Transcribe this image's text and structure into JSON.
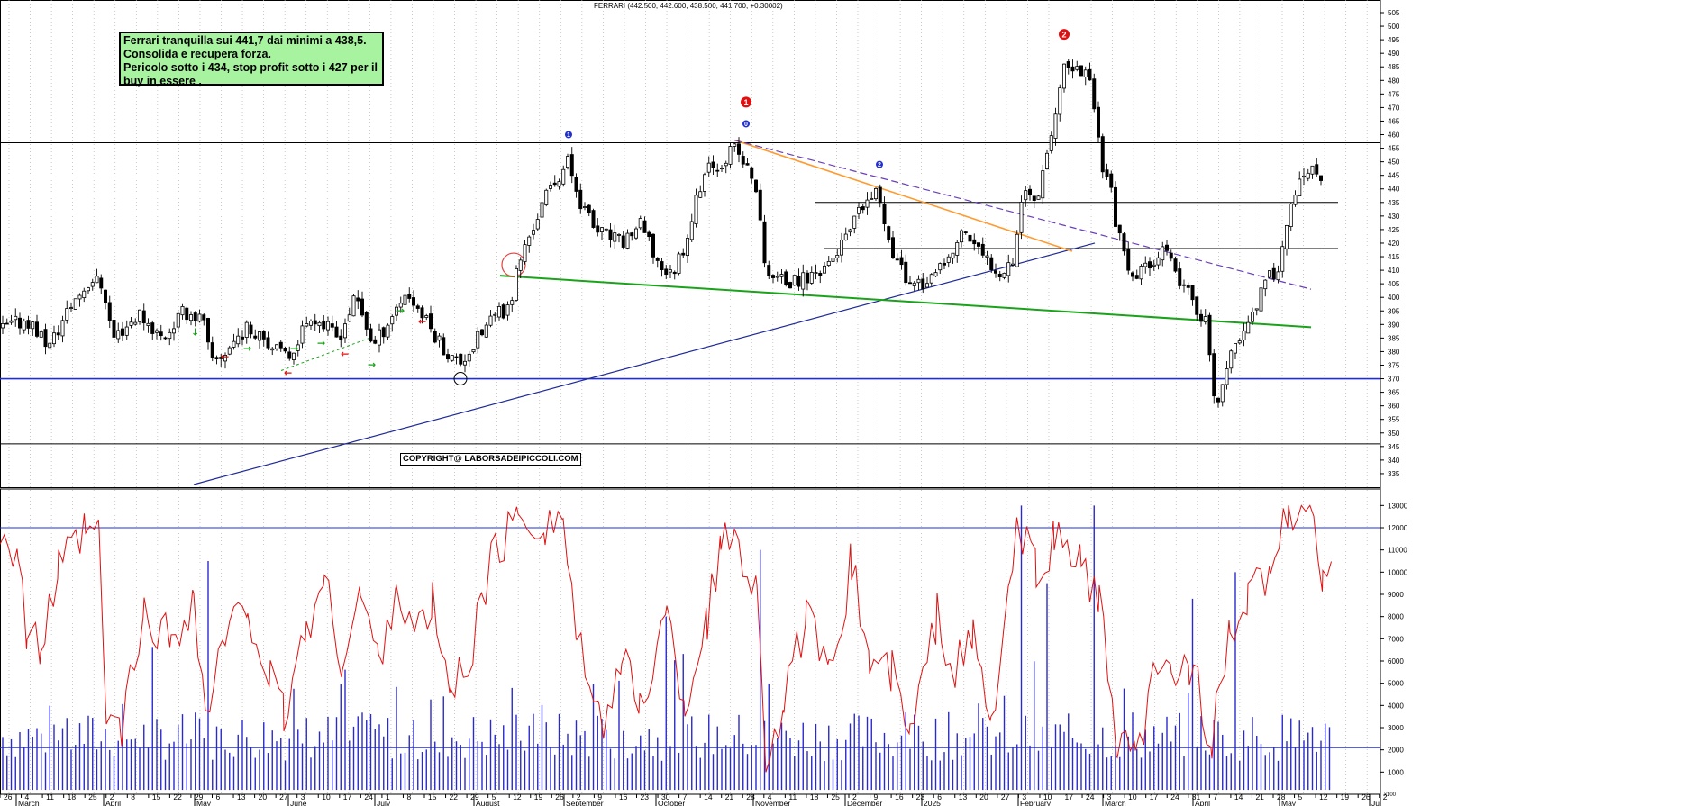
{
  "title": "FERRARI (442.500, 442.600, 438.500, 441.700, +0.30002)",
  "note": {
    "lines": [
      "Ferrari tranquilla sui 441,7 dai minimi a 438,5.",
      "Consolida e recupera forza.",
      "Pericolo sotto i 434, stop profit sotto i 427 per il",
      "buy in essere ."
    ]
  },
  "copyright": "COPYRIGHT@ LABORSADEIPICCOLI.COM",
  "colors": {
    "candle": "#000000",
    "hline": "#000000",
    "support": "#1f2fd0",
    "uptrend": "#1f2a9a",
    "green_trend": "#1aa31a",
    "orange_trend": "#ff9a2e",
    "dashed_trend": "#6a3fb8",
    "volume": "#2a2acc",
    "oscillator": "#e01010",
    "marker_red": "#e01010",
    "marker_blue": "#1f2fd0",
    "note_bg": "#a7f3a0"
  },
  "chart_data": [
    {
      "type": "candlestick",
      "title": "FERRARI (442.500, 442.600, 438.500, 441.700, +0.30002)",
      "y_axis": {
        "range": [
          330,
          505
        ],
        "ticks": [
          335,
          340,
          345,
          350,
          355,
          360,
          365,
          370,
          375,
          380,
          385,
          390,
          395,
          400,
          405,
          410,
          415,
          420,
          425,
          430,
          435,
          440,
          445,
          450,
          455,
          460,
          465,
          470,
          475,
          480,
          485,
          490,
          495,
          500,
          505
        ]
      },
      "months": [
        "March",
        "April",
        "May",
        "June",
        "July",
        "August",
        "September",
        "October",
        "November",
        "December",
        "2025",
        "February",
        "March",
        "April",
        "May",
        "Jui"
      ],
      "day_ticks": [
        "26",
        "4",
        "11",
        "18",
        "25",
        "2",
        "8",
        "15",
        "22",
        "29",
        "6",
        "13",
        "20",
        "27",
        "3",
        "10",
        "17",
        "24",
        "1",
        "8",
        "15",
        "22",
        "29",
        "5",
        "12",
        "19",
        "26",
        "2",
        "9",
        "16",
        "23",
        "30",
        "7",
        "14",
        "21",
        "28",
        "4",
        "11",
        "18",
        "25",
        "2",
        "9",
        "16",
        "23",
        "6",
        "13",
        "20",
        "27",
        "3",
        "10",
        "17",
        "24",
        "3",
        "10",
        "17",
        "24",
        "31",
        "7",
        "14",
        "21",
        "28",
        "5",
        "12",
        "19",
        "26",
        "2"
      ],
      "path": [
        [
          0,
          388
        ],
        [
          30,
          392
        ],
        [
          55,
          382
        ],
        [
          80,
          398
        ],
        [
          102,
          407
        ],
        [
          115,
          404
        ],
        [
          125,
          385
        ],
        [
          155,
          394
        ],
        [
          180,
          385
        ],
        [
          205,
          395
        ],
        [
          225,
          392
        ],
        [
          235,
          375
        ],
        [
          250,
          380
        ],
        [
          270,
          388
        ],
        [
          290,
          388
        ],
        [
          305,
          380
        ],
        [
          320,
          378
        ],
        [
          345,
          394
        ],
        [
          375,
          385
        ],
        [
          395,
          400
        ],
        [
          415,
          382
        ],
        [
          425,
          388
        ],
        [
          450,
          402
        ],
        [
          460,
          398
        ],
        [
          475,
          390
        ],
        [
          500,
          378
        ],
        [
          510,
          376
        ],
        [
          525,
          382
        ],
        [
          545,
          392
        ],
        [
          565,
          396
        ],
        [
          575,
          412
        ],
        [
          590,
          425
        ],
        [
          610,
          440
        ],
        [
          630,
          450
        ],
        [
          645,
          435
        ],
        [
          660,
          425
        ],
        [
          690,
          420
        ],
        [
          710,
          427
        ],
        [
          730,
          413
        ],
        [
          745,
          408
        ],
        [
          760,
          420
        ],
        [
          780,
          445
        ],
        [
          800,
          450
        ],
        [
          815,
          455
        ],
        [
          825,
          450
        ],
        [
          840,
          440
        ],
        [
          848,
          412
        ],
        [
          860,
          407
        ],
        [
          880,
          405
        ],
        [
          900,
          408
        ],
        [
          920,
          413
        ],
        [
          940,
          422
        ],
        [
          960,
          435
        ],
        [
          975,
          438
        ],
        [
          990,
          418
        ],
        [
          1005,
          407
        ],
        [
          1030,
          405
        ],
        [
          1050,
          412
        ],
        [
          1070,
          425
        ],
        [
          1090,
          415
        ],
        [
          1110,
          410
        ],
        [
          1125,
          415
        ],
        [
          1135,
          440
        ],
        [
          1150,
          436
        ],
        [
          1160,
          452
        ],
        [
          1170,
          465
        ],
        [
          1180,
          483
        ],
        [
          1190,
          485
        ],
        [
          1200,
          483
        ],
        [
          1210,
          482
        ],
        [
          1222,
          450
        ],
        [
          1230,
          445
        ],
        [
          1240,
          425
        ],
        [
          1255,
          405
        ],
        [
          1275,
          413
        ],
        [
          1290,
          418
        ],
        [
          1305,
          408
        ],
        [
          1320,
          400
        ],
        [
          1340,
          390
        ],
        [
          1345,
          364
        ],
        [
          1350,
          360
        ],
        [
          1360,
          372
        ],
        [
          1375,
          385
        ],
        [
          1390,
          395
        ],
        [
          1405,
          405
        ],
        [
          1420,
          413
        ],
        [
          1430,
          430
        ],
        [
          1440,
          440
        ],
        [
          1450,
          445
        ],
        [
          1460,
          446
        ],
        [
          1470,
          442
        ]
      ],
      "lines": {
        "support": 370,
        "support2": 346,
        "resistance": 457,
        "hline_435": 435,
        "hline_418": 418
      },
      "markers": [
        {
          "label": "1",
          "color": "blue",
          "date_index": "Sep 2",
          "price": 460
        },
        {
          "label": "0",
          "color": "blue",
          "date_index": "Oct 28",
          "price": 464
        },
        {
          "label": "1",
          "color": "red",
          "date_index": "Oct 28",
          "price": 468
        },
        {
          "label": "2",
          "color": "blue",
          "date_index": "Dec 9",
          "price": 449
        },
        {
          "label": "2",
          "color": "red",
          "date_index": "Feb 17",
          "price": 497
        }
      ]
    },
    {
      "type": "bar+line",
      "title": "Volume and oscillator",
      "y_axis": {
        "range": [
          0,
          13500
        ],
        "ticks": [
          1000,
          2000,
          3000,
          4000,
          5000,
          6000,
          7000,
          8000,
          9000,
          10000,
          11000,
          12000,
          13000
        ]
      },
      "reference_lines": [
        12000,
        2100
      ]
    }
  ]
}
